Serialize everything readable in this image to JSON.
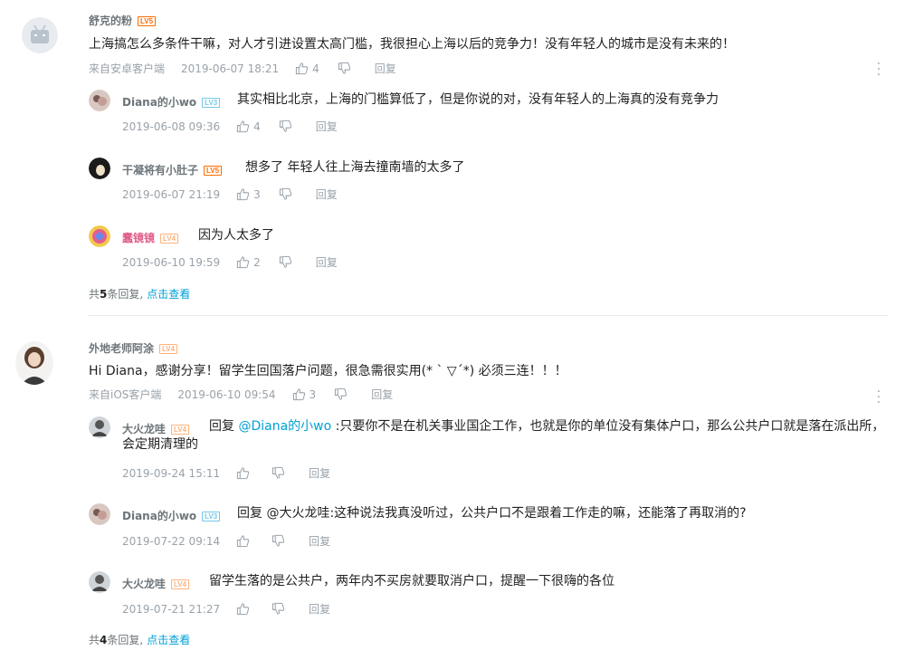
{
  "threads": [
    {
      "author": "舒克的粉",
      "level": "LV5",
      "text": "上海搞怎么多条件干嘛，对人才引进设置太高门槛，我很担心上海以后的竞争力！没有年轻人的城市是没有未来的！",
      "source": "来自安卓客户端",
      "time": "2019-06-07 18:21",
      "likes": "4",
      "reply_label": "回复",
      "replies": [
        {
          "author": "Diana的小wo",
          "level": "LV3",
          "text": "其实相比北京，上海的门槛算低了，但是你说的对，没有年轻人的上海真的没有竞争力",
          "time": "2019-06-08 09:36",
          "likes": "4",
          "reply_label": "回复"
        },
        {
          "author": "干凝将有小肚子",
          "level": "LV5",
          "text": "想多了 年轻人往上海去撞南墙的太多了",
          "time": "2019-06-07 21:19",
          "likes": "3",
          "reply_label": "回复"
        },
        {
          "author": "蠢镜镜",
          "level": "LV4",
          "text": "因为人太多了",
          "time": "2019-06-10 19:59",
          "likes": "2",
          "reply_label": "回复"
        }
      ],
      "more": {
        "prefix": "共",
        "count": "5",
        "suffix": "条回复,",
        "link": "点击查看"
      }
    },
    {
      "author": "外地老师阿涂",
      "level": "LV4",
      "text": "Hi Diana，感谢分享！留学生回国落户问题，很急需很实用(* ` ▽´*) 必须三连！！！",
      "source": "来自iOS客户端",
      "time": "2019-06-10 09:54",
      "likes": "3",
      "reply_label": "回复",
      "replies": [
        {
          "author": "大火龙哇",
          "level": "LV4",
          "reply_prefix": "回复 ",
          "mention": "@Diana的小wo",
          "text": " :只要你不是在机关事业国企工作，也就是你的单位没有集体户口，那么公共户口就是落在派出所，会定期清理的",
          "time": "2019-09-24 15:11",
          "likes": "",
          "reply_label": "回复"
        },
        {
          "author": "Diana的小wo",
          "level": "LV3",
          "text": "回复 @大火龙哇:这种说法我真没听过，公共户口不是跟着工作走的嘛，还能落了再取消的?",
          "time": "2019-07-22 09:14",
          "likes": "",
          "reply_label": "回复"
        },
        {
          "author": "大火龙哇",
          "level": "LV4",
          "text": "留学生落的是公共户，两年内不买房就要取消户口，提醒一下很嗨的各位",
          "time": "2019-07-21 21:27",
          "likes": "",
          "reply_label": "回复"
        }
      ],
      "more": {
        "prefix": "共",
        "count": "4",
        "suffix": "条回复,",
        "link": "点击查看"
      }
    }
  ],
  "colors": {
    "link": "#00a1d6",
    "meta": "#99a2aa",
    "level_orange": "#ff6c00",
    "level_blue": "#73c9e5"
  }
}
